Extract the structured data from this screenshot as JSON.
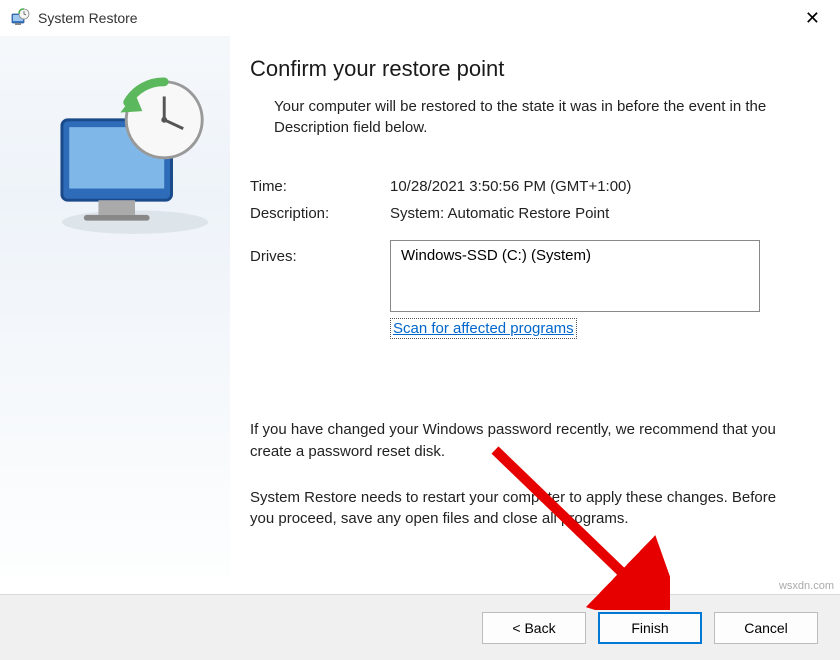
{
  "titlebar": {
    "title": "System Restore"
  },
  "main": {
    "heading": "Confirm your restore point",
    "subtext": "Your computer will be restored to the state it was in before the event in the Description field below.",
    "time_label": "Time:",
    "time_value": "10/28/2021 3:50:56 PM (GMT+1:00)",
    "description_label": "Description:",
    "description_value": "System: Automatic Restore Point",
    "drives_label": "Drives:",
    "drives_value": "Windows-SSD (C:) (System)",
    "scan_link": "Scan for affected programs",
    "note_password": "If you have changed your Windows password recently, we recommend that you create a password reset disk.",
    "note_restart": "System Restore needs to restart your computer to apply these changes. Before you proceed, save any open files and close all programs."
  },
  "footer": {
    "back": "< Back",
    "finish": "Finish",
    "cancel": "Cancel"
  },
  "watermark": "wsxdn.com"
}
